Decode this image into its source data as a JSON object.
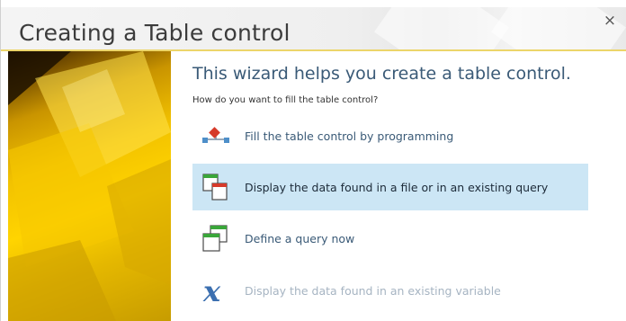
{
  "window": {
    "title": "Creating a Table control",
    "close_label": "×"
  },
  "wizard": {
    "heading": "This wizard helps you create a table control.",
    "question": "How do you want to fill the table control?",
    "options": [
      {
        "label": "Fill the table control by programming",
        "icon": "programming-flow-icon",
        "selected": false,
        "enabled": true
      },
      {
        "label": "Display the data found in a file or in an existing query",
        "icon": "file-query-icon",
        "selected": true,
        "enabled": true
      },
      {
        "label": "Define a query now",
        "icon": "define-query-icon",
        "selected": false,
        "enabled": true
      },
      {
        "label": "Display the data found in an existing variable",
        "icon": "variable-x-icon",
        "selected": false,
        "enabled": false
      }
    ]
  },
  "colors": {
    "selection": "#cce6f5",
    "accent_border": "#ecd56a",
    "link_text": "#3a5a77",
    "disabled_text": "#a6b4c2"
  }
}
